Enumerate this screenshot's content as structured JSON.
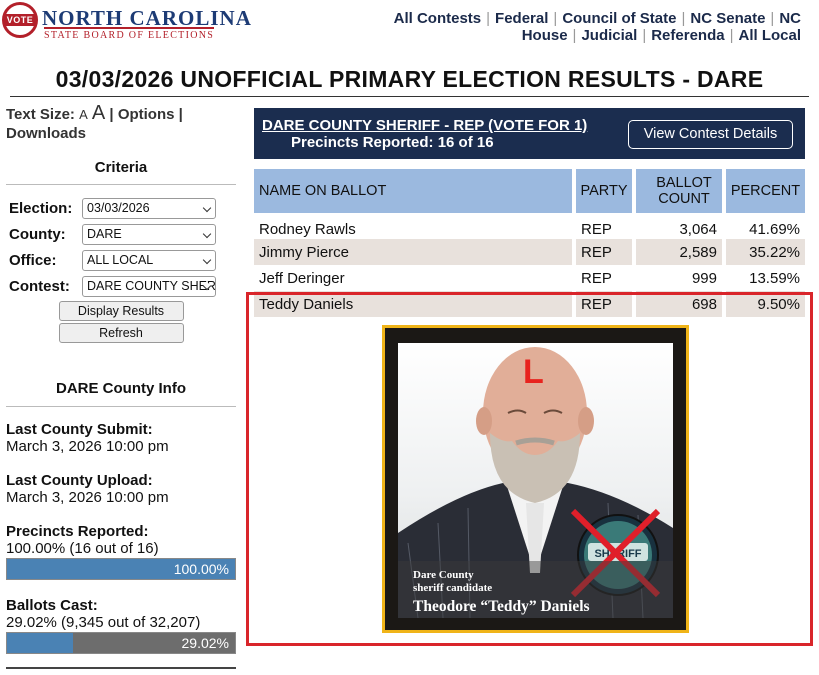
{
  "header": {
    "logo_badge": "VOTE",
    "logo_title": "NORTH CAROLINA",
    "logo_subtitle": "STATE BOARD OF ELECTIONS",
    "nav": [
      "All Contests",
      "Federal",
      "Council of State",
      "NC Senate",
      "NC House",
      "Judicial",
      "Referenda",
      "All Local"
    ]
  },
  "page_title": "03/03/2026 UNOFFICIAL PRIMARY ELECTION RESULTS - DARE",
  "sidebar": {
    "text_size_label": "Text Size:",
    "size_small": "A",
    "size_large": "A",
    "options": "Options",
    "downloads": "Downloads",
    "criteria_title": "Criteria",
    "criteria": [
      {
        "label": "Election:",
        "value": "03/03/2026"
      },
      {
        "label": "County:",
        "value": "DARE"
      },
      {
        "label": "Office:",
        "value": "ALL LOCAL"
      },
      {
        "label": "Contest:",
        "value": "DARE COUNTY SHERIFF - REP"
      }
    ],
    "display_results": "Display Results",
    "refresh": "Refresh",
    "county_info_title": "DARE County Info",
    "last_submit_label": "Last County Submit:",
    "last_submit_value": "March 3, 2026 10:00 pm",
    "last_upload_label": "Last County Upload:",
    "last_upload_value": "March 3, 2026 10:00 pm",
    "precincts_label": "Precincts Reported:",
    "precincts_value": "100.00% (16 out of 16)",
    "precincts_bar_text": "100.00%",
    "precincts_fraction": 1.0,
    "ballots_label": "Ballots Cast:",
    "ballots_value": "29.02% (9,345 out of 32,207)",
    "ballots_bar_text": "29.02%",
    "ballots_fraction": 0.2902
  },
  "contest": {
    "title": "DARE COUNTY SHERIFF - REP (VOTE FOR 1)",
    "precincts": "Precincts Reported: 16 of 16",
    "view_details": "View Contest Details",
    "columns": {
      "name": "NAME ON BALLOT",
      "party": "PARTY",
      "count": "BALLOT COUNT",
      "percent": "PERCENT"
    },
    "candidates": [
      {
        "name": "Rodney Rawls",
        "party": "REP",
        "count": "3,064",
        "percent": "41.69%"
      },
      {
        "name": "Jimmy Pierce",
        "party": "REP",
        "count": "2,589",
        "percent": "35.22%"
      },
      {
        "name": "Jeff Deringer",
        "party": "REP",
        "count": "999",
        "percent": "13.59%"
      },
      {
        "name": "Teddy Daniels",
        "party": "REP",
        "count": "698",
        "percent": "9.50%"
      }
    ]
  },
  "candidate_image": {
    "mark": "L",
    "caption_line1": "Dare County",
    "caption_line2": "sheriff candidate",
    "caption_name": "Theodore “Teddy” Daniels",
    "badge_text": "SHERIFF",
    "accent": "#d9252a",
    "frame_color": "#f0b418"
  }
}
